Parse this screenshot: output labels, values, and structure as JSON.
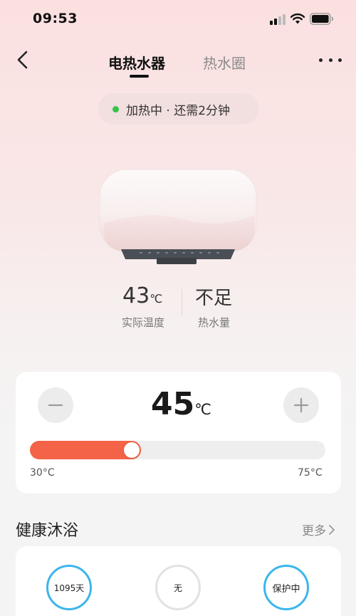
{
  "status_bar": {
    "time": "09:53",
    "signal_icon": "cellular-signal-icon",
    "wifi_icon": "wifi-icon",
    "battery_icon": "battery-icon"
  },
  "nav": {
    "back_icon": "chevron-left-icon",
    "tabs": [
      {
        "label": "电热水器",
        "active": true
      },
      {
        "label": "热水圈",
        "active": false
      }
    ],
    "more_icon": "more-dots-icon"
  },
  "status": {
    "text": "加热中 · 还需2分钟",
    "indicator_color": "#35c24a"
  },
  "device": {
    "image": "water-heater-illustration"
  },
  "readings": {
    "actual_temp_value": "43",
    "actual_temp_unit": "℃",
    "actual_temp_label": "实际温度",
    "hot_water_value": "不足",
    "hot_water_label": "热水量"
  },
  "control": {
    "set_temp_value": "45",
    "set_temp_unit": "℃",
    "minus_icon": "minus-icon",
    "plus_icon": "plus-icon",
    "range_min_label": "30°C",
    "range_max_label": "75°C",
    "min": 30,
    "max": 75,
    "value": 45,
    "accent_color": "#f46347"
  },
  "health_bath": {
    "title": "健康沐浴",
    "more_label": "更多",
    "more_icon": "chevron-right-icon",
    "items": [
      {
        "label": "1095天",
        "ring_color": "#3bb6ec"
      },
      {
        "label": "无",
        "ring_color": "#e2e2e2"
      },
      {
        "label": "保护中",
        "ring_color": "#3bb6ec"
      }
    ]
  }
}
